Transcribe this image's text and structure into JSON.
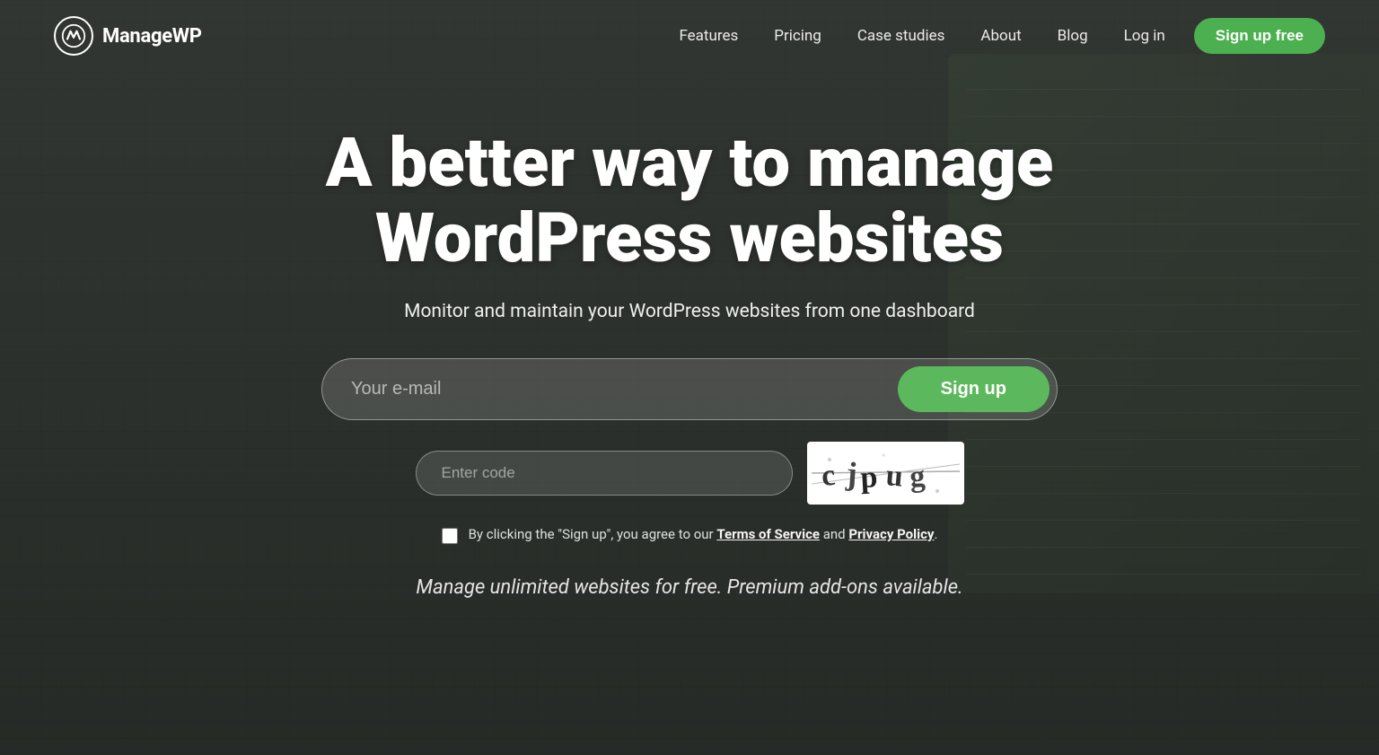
{
  "brand": {
    "name": "ManageWP",
    "logo_alt": "ManageWP logo"
  },
  "nav": {
    "links": [
      {
        "label": "Features",
        "name": "nav-features"
      },
      {
        "label": "Pricing",
        "name": "nav-pricing"
      },
      {
        "label": "Case studies",
        "name": "nav-case-studies"
      },
      {
        "label": "About",
        "name": "nav-about"
      },
      {
        "label": "Blog",
        "name": "nav-blog"
      },
      {
        "label": "Log in",
        "name": "nav-login"
      }
    ],
    "signup_label": "Sign up free"
  },
  "hero": {
    "title": "A better way to manage WordPress websites",
    "subtitle": "Monitor and maintain your WordPress websites from one dashboard"
  },
  "email_form": {
    "email_placeholder": "Your e-mail",
    "signup_btn": "Sign up",
    "captcha_placeholder": "Enter code",
    "captcha_code": "cjpug",
    "terms_text": "By clicking the \"Sign up\", you agree to our ",
    "terms_of_service": "Terms of Service",
    "terms_and": " and ",
    "privacy_policy": "Privacy Policy",
    "terms_end": "."
  },
  "promo": {
    "text": "Manage unlimited websites for free. Premium add-ons available."
  },
  "colors": {
    "green": "#5cb85c",
    "nav_green": "#4caf50"
  }
}
